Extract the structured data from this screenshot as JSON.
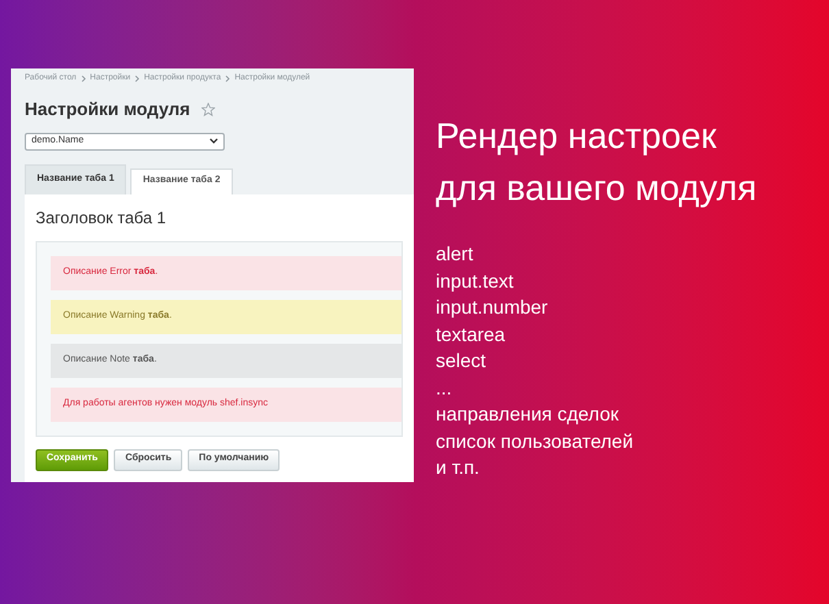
{
  "screenshot": {
    "breadcrumbs": [
      "Рабочий стол",
      "Настройки",
      "Настройки продукта",
      "Настройки модулей"
    ],
    "title": "Настройки модуля",
    "favorite": false,
    "select": {
      "value": "demo.Name"
    },
    "tabs": [
      {
        "label": "Название таба 1",
        "selected": true
      },
      {
        "label": "Название таба 2",
        "selected": false
      }
    ],
    "tab_heading": "Заголовок таба 1",
    "alerts": [
      {
        "kind": "error",
        "text": "Описание Error **таба**."
      },
      {
        "kind": "warning",
        "text": "Описание Warning **таба**."
      },
      {
        "kind": "note",
        "text": "Описание Note **таба**."
      },
      {
        "kind": "error",
        "text": "Для работы агентов нужен модуль shef.insync"
      }
    ],
    "buttons": [
      {
        "label": "Сохранить",
        "kind": "primary"
      },
      {
        "label": "Сбросить",
        "kind": "default"
      },
      {
        "label": "По умолчанию",
        "kind": "default"
      }
    ]
  },
  "headline": [
    "Рендер настроек",
    "для вашего модуля"
  ],
  "features": [
    "alert",
    "input.text",
    "input.number",
    "textarea",
    "select",
    "...",
    "направления сделок",
    "список пользователей",
    "и т.п."
  ]
}
